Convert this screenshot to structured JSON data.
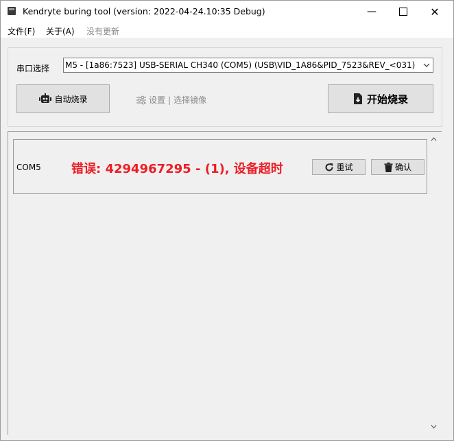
{
  "window": {
    "title": "Kendryte buring tool (version: 2022-04-24.10:35 Debug)",
    "minimize_glyph": "—",
    "close_glyph": "✕"
  },
  "menu": {
    "items": [
      {
        "label": "文件(F)",
        "enabled": true
      },
      {
        "label": "关于(A)",
        "enabled": true
      },
      {
        "label": "没有更新",
        "enabled": false
      }
    ]
  },
  "port": {
    "label": "串口选择",
    "selected": "M5 - [1a86:7523] USB-SERIAL CH340 (COM5) (USB\\VID_1A86&PID_7523&REV_<031)"
  },
  "toolbar": {
    "auto_burn_label": "自动烧录",
    "settings_label": "设置",
    "separator": "|",
    "select_image_label": "选择镜像",
    "start_label": "开始烧录"
  },
  "devices": [
    {
      "port": "COM5",
      "error": "错误: 4294967295 - (1), 设备超时",
      "retry_label": "重试",
      "confirm_label": "确认"
    }
  ],
  "colors": {
    "error": "#ee1c24",
    "disabled_text": "#8a8a8a"
  },
  "icons": {
    "auto_burn": "robot-icon",
    "settings": "sliders-icon",
    "start": "file-download-icon",
    "retry": "redo-icon",
    "confirm": "trash-icon"
  }
}
